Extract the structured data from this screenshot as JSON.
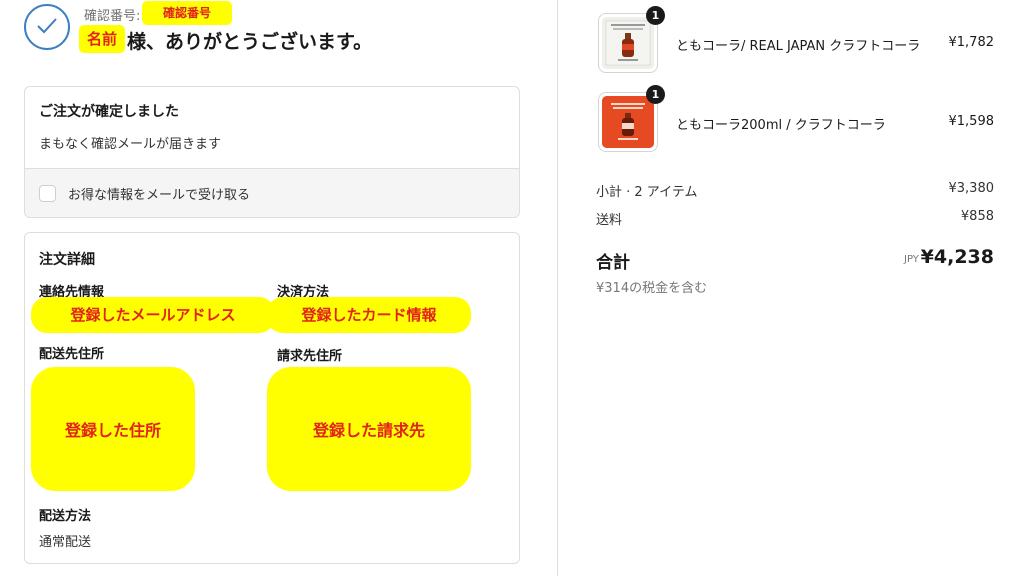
{
  "header": {
    "confirmation_label": "確認番号:",
    "confirmation_value": "確認番号",
    "name_value": "名前",
    "thanks": "様、ありがとうございます。"
  },
  "order_confirmed": {
    "title": "ご注文が確定しました",
    "subtitle": "まもなく確認メールが届きます",
    "email_opt_in_label": "お得な情報をメールで受け取る",
    "email_opt_in_checked": false
  },
  "order_details": {
    "title": "注文詳細",
    "contact_label": "連絡先情報",
    "contact_value": "登録したメールアドレス",
    "payment_label": "決済方法",
    "payment_value": "登録したカード情報",
    "shipping_address_label": "配送先住所",
    "shipping_address_value": "登録した住所",
    "billing_address_label": "請求先住所",
    "billing_address_value": "登録した請求先",
    "shipping_method_label": "配送方法",
    "shipping_method_value": "通常配送"
  },
  "cart": {
    "items": [
      {
        "name": "ともコーラ/ REAL JAPAN クラフトコーラ",
        "price": "¥1,782",
        "qty": "1",
        "thumb_color": "#eeeeea",
        "thumb_text": "ともコーラ"
      },
      {
        "name": "ともコーラ200ml / クラフトコーラ",
        "price": "¥1,598",
        "qty": "1",
        "thumb_color": "#e64a22",
        "thumb_text": "ともコーラ"
      }
    ],
    "subtotal_label": "小計 · 2 アイテム",
    "subtotal_value": "¥3,380",
    "shipping_label": "送料",
    "shipping_value": "¥858",
    "total_label": "合計",
    "total_currency": "JPY",
    "total_value": "¥4,238",
    "tax_note": "¥314の税金を含む"
  },
  "colors": {
    "accent": "#3d7fc2",
    "highlight_bg": "#ffff00",
    "highlight_text": "#e2231a"
  }
}
